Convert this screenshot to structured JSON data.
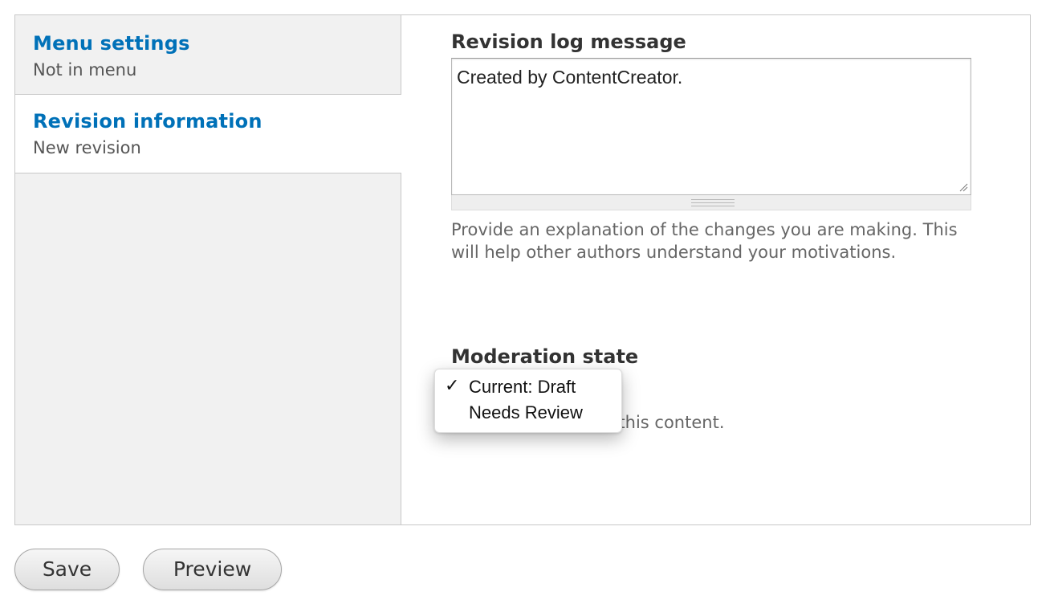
{
  "sidebar": {
    "tabs": [
      {
        "title": "Menu settings",
        "summary": "Not in menu"
      },
      {
        "title": "Revision information",
        "summary": "New revision"
      }
    ]
  },
  "revision_log": {
    "label": "Revision log message",
    "value": "Created by ContentCreator.",
    "description": "Provide an explanation of the changes you are making. This will help other authors understand your motivations."
  },
  "moderation": {
    "label": "Moderation state",
    "description_visible": "n state for this content.",
    "options": [
      {
        "label": "Current: Draft",
        "selected": true
      },
      {
        "label": "Needs Review",
        "selected": false
      }
    ]
  },
  "actions": {
    "save_label": "Save",
    "preview_label": "Preview"
  },
  "colors": {
    "link": "#0071b8",
    "sidebar_bg": "#f1f1f1",
    "border": "#c8c8c8"
  }
}
